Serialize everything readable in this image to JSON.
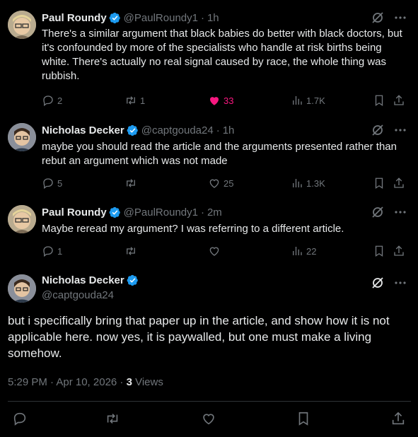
{
  "tweets": [
    {
      "name": "Paul Roundy",
      "handle": "@PaulRoundy1",
      "time": "1h",
      "text": "There's a similar argument that black babies do better with black doctors, but it's confounded by more of the specialists who handle at risk births being white. There's actually no real signal caused by race, the whole thing was rubbish.",
      "replies": "2",
      "reposts": "1",
      "likes": "33",
      "views": "1.7K",
      "liked": true
    },
    {
      "name": "Nicholas Decker",
      "handle": "@captgouda24",
      "time": "1h",
      "text": "maybe you should read the article and the arguments presented rather than rebut an argument which was not made",
      "replies": "5",
      "reposts": "",
      "likes": "25",
      "views": "1.3K",
      "liked": false
    },
    {
      "name": "Paul Roundy",
      "handle": "@PaulRoundy1",
      "time": "2m",
      "text": "Maybe reread my argument? I was referring to a different article.",
      "replies": "1",
      "reposts": "",
      "likes": "",
      "views": "22",
      "liked": false
    }
  ],
  "main": {
    "name": "Nicholas Decker",
    "handle": "@captgouda24",
    "text": "but i specifically bring that paper up in the article, and show how it is not applicable here. now yes, it is paywalled, but one must make a living somehow.",
    "timestamp": "5:29 PM · Apr 10, 2026 · ",
    "views_count": "3",
    "views_label": " Views"
  },
  "colors": {
    "verified": "#1d9bf0",
    "like": "#f91880",
    "muted": "#71767b"
  },
  "icons": [
    "verified-badge-icon",
    "grok-icon",
    "more-icon",
    "reply-icon",
    "repost-icon",
    "like-icon",
    "views-icon",
    "bookmark-icon",
    "share-icon"
  ]
}
